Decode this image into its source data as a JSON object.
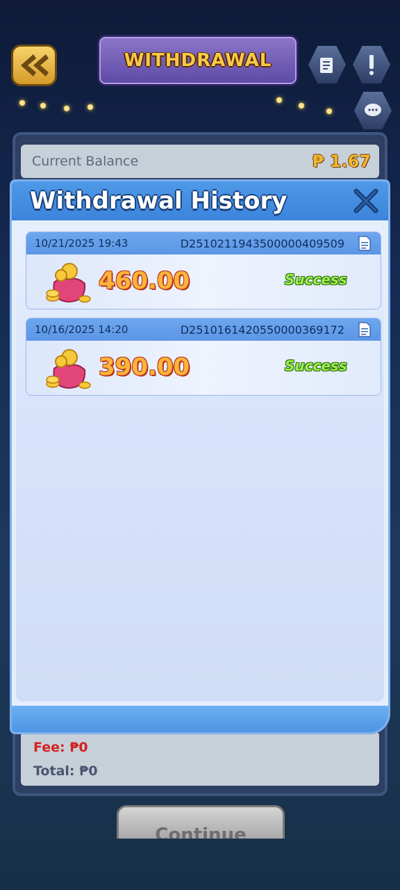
{
  "header": {
    "title": "WITHDRAWAL"
  },
  "balance": {
    "label": "Current Balance",
    "value": "₱ 1.67"
  },
  "modal": {
    "title": "Withdrawal History",
    "records": [
      {
        "datetime": "10/21/2025 19:43",
        "order_id": "D2510211943500000409509",
        "amount": "460.00",
        "status": "Success"
      },
      {
        "datetime": "10/16/2025 14:20",
        "order_id": "D2510161420550000369172",
        "amount": "390.00",
        "status": "Success"
      }
    ]
  },
  "summary": {
    "fee": "Fee: ₱0",
    "total": "Total: ₱0"
  },
  "actions": {
    "continue_label": "Continue"
  },
  "colors": {
    "modal_header": "#3b84db",
    "amount": "#ffb43a",
    "status_success": "#9cf04a",
    "fee": "#d32222",
    "balance_value": "#f1b733"
  },
  "icons": [
    "back-arrow-icon",
    "notebook-icon",
    "alert-icon",
    "chat-icon",
    "close-icon",
    "document-icon",
    "coin-purse-icon"
  ]
}
